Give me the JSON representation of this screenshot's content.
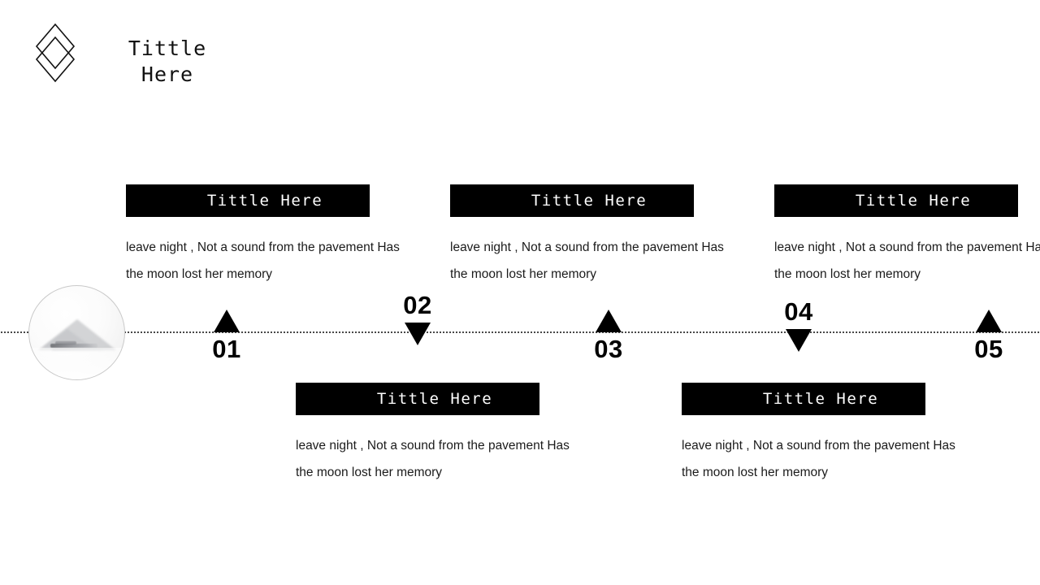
{
  "header": {
    "title": "Tittle\nHere",
    "logo_icon": "double-diamond-logo-icon"
  },
  "globe": {
    "name": "globe-sphere-image",
    "accent": "#f2f2f2"
  },
  "timeline": {
    "axis_name": "timeline-dotted-axis",
    "markers": [
      {
        "number": "01",
        "direction": "up",
        "triangle_icon": "triangle-up-icon"
      },
      {
        "number": "02",
        "direction": "down",
        "triangle_icon": "triangle-down-icon"
      },
      {
        "number": "03",
        "direction": "up",
        "triangle_icon": "triangle-up-icon"
      },
      {
        "number": "04",
        "direction": "down",
        "triangle_icon": "triangle-down-icon"
      },
      {
        "number": "05",
        "direction": "up",
        "triangle_icon": "triangle-up-icon"
      }
    ]
  },
  "blocks": [
    {
      "label": "Tittle Here",
      "body": "leave night , Not a sound from the pavement Has the moon lost her memory",
      "position": "above"
    },
    {
      "label": "Tittle Here",
      "body": "leave night , Not a sound from the pavement Has the moon lost her memory",
      "position": "below"
    },
    {
      "label": "Tittle Here",
      "body": "leave night , Not a sound from the pavement Has the moon lost her memory",
      "position": "above"
    },
    {
      "label": "Tittle Here",
      "body": "leave night , Not a sound from the pavement Has the moon lost her memory",
      "position": "below"
    },
    {
      "label": "Tittle Here",
      "body": "leave night , Not a sound from the pavement Has the moon lost her memory",
      "position": "above"
    }
  ],
  "colors": {
    "label_background": "#000000",
    "label_text": "#ffffff",
    "body_text": "#1b1b1b",
    "marker": "#000000"
  }
}
